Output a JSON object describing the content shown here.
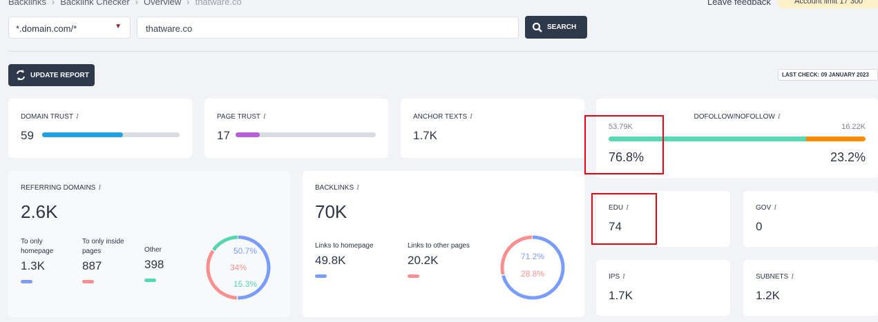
{
  "breadcrumb": [
    "Backlinks",
    "Backlink Checker",
    "Overview",
    "thatware.co"
  ],
  "header": {
    "leave_feedback": "Leave feedback",
    "account_limit": "Account limit 17 300"
  },
  "search": {
    "scope": "*.domain.com/*",
    "query": "thatware.co",
    "button": "SEARCH"
  },
  "update_report": "UPDATE REPORT",
  "last_check": "LAST CHECK: 09 JANUARY 2023",
  "colors": {
    "blue": "#7b9cff",
    "red": "#fb8f8f",
    "green": "#56d6ac",
    "trust": "#1fa1e0",
    "page": "#b65fd6",
    "dofollow": "#56d9b4",
    "nofollow": "#ff8c00"
  },
  "domain_trust": {
    "label": "DOMAIN TRUST",
    "value": "59",
    "percent": 59
  },
  "page_trust": {
    "label": "PAGE TRUST",
    "value": "17",
    "percent": 17
  },
  "anchor_texts": {
    "label": "ANCHOR TEXTS",
    "value": "1.7K"
  },
  "dofollow": {
    "label": "DOFOLLOW/NOFOLLOW",
    "do_count": "53.79K",
    "no_count": "16.22K",
    "do_pct": "76.8%",
    "no_pct": "23.2%",
    "do_value": 76.8
  },
  "referring": {
    "label": "REFERRING DOMAINS",
    "value": "2.6K",
    "items": [
      {
        "label": "To only homepage",
        "value": "1.3K"
      },
      {
        "label": "To only inside pages",
        "value": "887"
      },
      {
        "label": "Other",
        "value": "398"
      }
    ],
    "pcts": [
      "50.7%",
      "34%",
      "15.3%"
    ],
    "values": [
      50.7,
      34,
      15.3
    ]
  },
  "backlinks": {
    "label": "BACKLINKS",
    "value": "70K",
    "items": [
      {
        "label": "Links to homepage",
        "value": "49.8K"
      },
      {
        "label": "Links to other pages",
        "value": "20.2K"
      }
    ],
    "pcts": [
      "71.2%",
      "28.8%"
    ],
    "values": [
      71.2,
      28.8
    ]
  },
  "edu": {
    "label": "EDU",
    "value": "74"
  },
  "gov": {
    "label": "GOV",
    "value": "0"
  },
  "ips": {
    "label": "IPS",
    "value": "1.7K"
  },
  "subnets": {
    "label": "SUBNETS",
    "value": "1.2K"
  }
}
